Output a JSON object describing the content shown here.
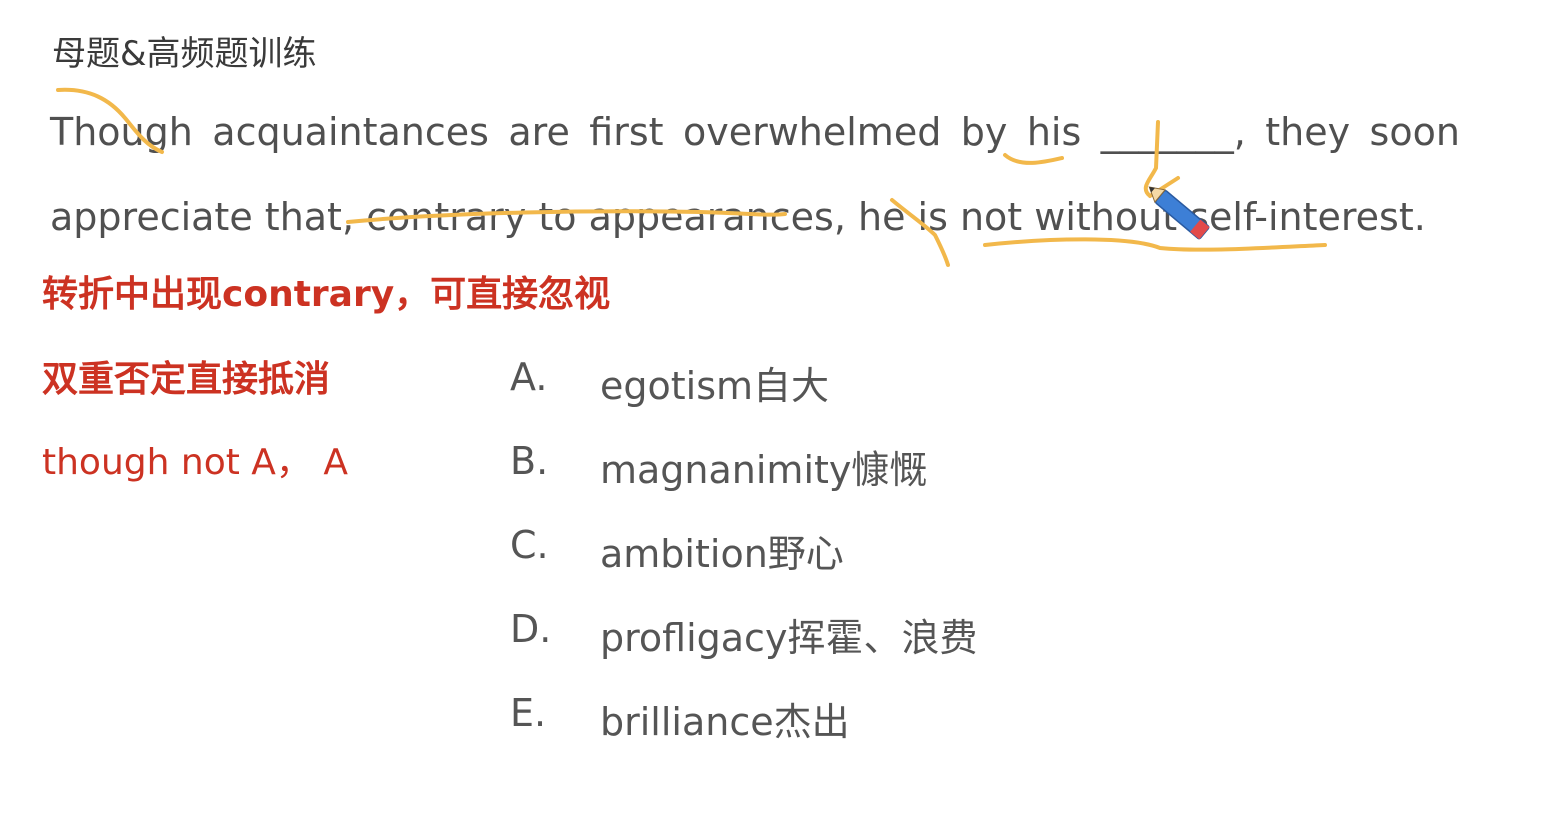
{
  "heading": "母题&高频题训练",
  "sentence": {
    "line1": {
      "w1": "Though",
      "w2": "acquaintances",
      "w3": "are",
      "w4": "first",
      "w5": "overwhelmed",
      "w6": "by",
      "w7": "his",
      "blank": "_______,",
      "w8": "they",
      "w9": "soon"
    },
    "line2": "appreciate that, contrary to appearances, he is not without self-interest."
  },
  "notes": [
    "转折中出现contrary，可直接忽视",
    "双重否定直接抵消",
    "though not A， A"
  ],
  "options": [
    {
      "letter": "A.",
      "text": "egotism自大"
    },
    {
      "letter": "B.",
      "text": "magnanimity慷慨"
    },
    {
      "letter": "C.",
      "text": "ambition野心"
    },
    {
      "letter": "D.",
      "text": "profligacy挥霍、浪费"
    },
    {
      "letter": "E.",
      "text": "brilliance杰出"
    }
  ],
  "annotation_color": "#f2b84b",
  "note_color": "#cc3222",
  "icons": [
    "pencil-cursor-icon"
  ]
}
